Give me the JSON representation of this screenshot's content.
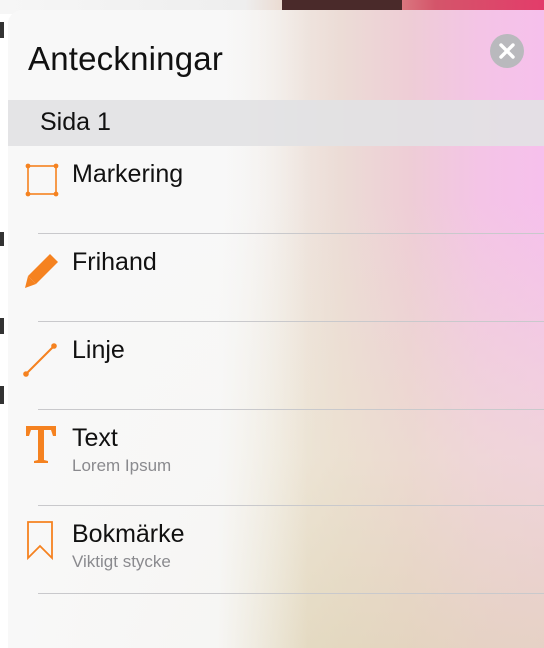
{
  "panel": {
    "title": "Anteckningar",
    "close_icon": "close-circle-icon"
  },
  "section": {
    "label": "Sida 1"
  },
  "items": [
    {
      "label": "Markering",
      "sublabel": "",
      "icon": "selection-rectangle-icon"
    },
    {
      "label": "Frihand",
      "sublabel": "",
      "icon": "pencil-icon"
    },
    {
      "label": "Linje",
      "sublabel": "",
      "icon": "line-icon"
    },
    {
      "label": "Text",
      "sublabel": "Lorem Ipsum",
      "icon": "text-icon"
    },
    {
      "label": "Bokmärke",
      "sublabel": "Viktigt stycke",
      "icon": "bookmark-icon"
    }
  ],
  "colors": {
    "accent": "#f58220",
    "close_button": "#b9b9bd",
    "section_background": "#e2e2e4",
    "sublabel": "#8a8a8e"
  }
}
